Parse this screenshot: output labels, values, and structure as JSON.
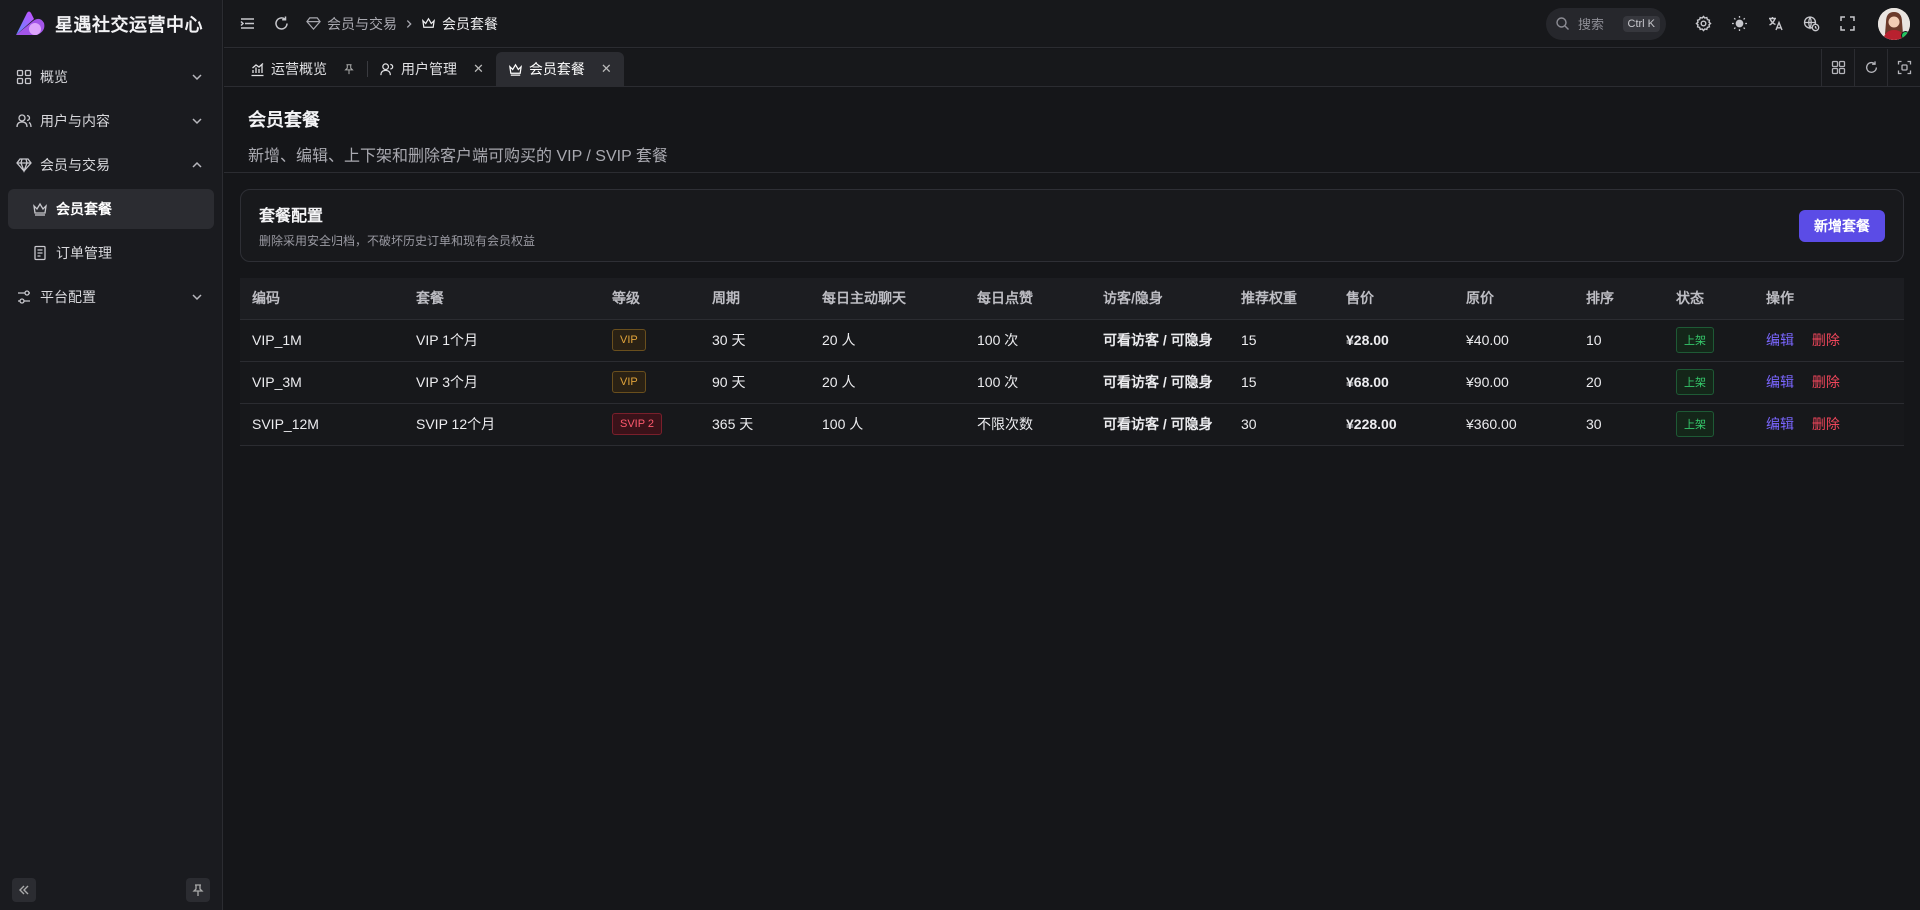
{
  "app": {
    "title": "星遇社交运营中心"
  },
  "sidebar": {
    "items": [
      {
        "label": "概览"
      },
      {
        "label": "用户与内容"
      },
      {
        "label": "会员与交易"
      },
      {
        "label": "会员套餐"
      },
      {
        "label": "订单管理"
      },
      {
        "label": "平台配置"
      }
    ]
  },
  "header": {
    "breadcrumb": [
      "会员与交易",
      "会员套餐"
    ],
    "search_placeholder": "搜索",
    "search_shortcut": "Ctrl K"
  },
  "tabs": [
    {
      "label": "运营概览"
    },
    {
      "label": "用户管理"
    },
    {
      "label": "会员套餐"
    }
  ],
  "page": {
    "title": "会员套餐",
    "description": "新增、编辑、上下架和删除客户端可购买的 VIP / SVIP 套餐"
  },
  "card": {
    "title": "套餐配置",
    "description": "删除采用安全归档，不破坏历史订单和现有会员权益",
    "add_button": "新增套餐"
  },
  "table": {
    "columns": [
      "编码",
      "套餐",
      "等级",
      "周期",
      "每日主动聊天",
      "每日点赞",
      "访客/隐身",
      "推荐权重",
      "售价",
      "原价",
      "排序",
      "状态",
      "操作"
    ],
    "rows": [
      {
        "code": "VIP_1M",
        "name": "VIP 1个月",
        "level": "VIP",
        "period": "30 天",
        "chat": "20 人",
        "likes": "100 次",
        "visitor": "可看访客 / 可隐身",
        "weight": "15",
        "price": "¥28.00",
        "original": "¥40.00",
        "sort": "10",
        "status": "上架",
        "edit": "编辑",
        "delete": "删除"
      },
      {
        "code": "VIP_3M",
        "name": "VIP 3个月",
        "level": "VIP",
        "period": "90 天",
        "chat": "20 人",
        "likes": "100 次",
        "visitor": "可看访客 / 可隐身",
        "weight": "15",
        "price": "¥68.00",
        "original": "¥90.00",
        "sort": "20",
        "status": "上架",
        "edit": "编辑",
        "delete": "删除"
      },
      {
        "code": "SVIP_12M",
        "name": "SVIP 12个月",
        "level": "SVIP 2",
        "period": "365 天",
        "chat": "100 人",
        "likes": "不限次数",
        "visitor": "可看访客 / 可隐身",
        "weight": "30",
        "price": "¥228.00",
        "original": "¥360.00",
        "sort": "30",
        "status": "上架",
        "edit": "编辑",
        "delete": "删除"
      }
    ]
  },
  "colors": {
    "accent": "#5b4ce6",
    "danger": "#f0465b",
    "success": "#35c76a",
    "vip": "#e0a33a"
  }
}
